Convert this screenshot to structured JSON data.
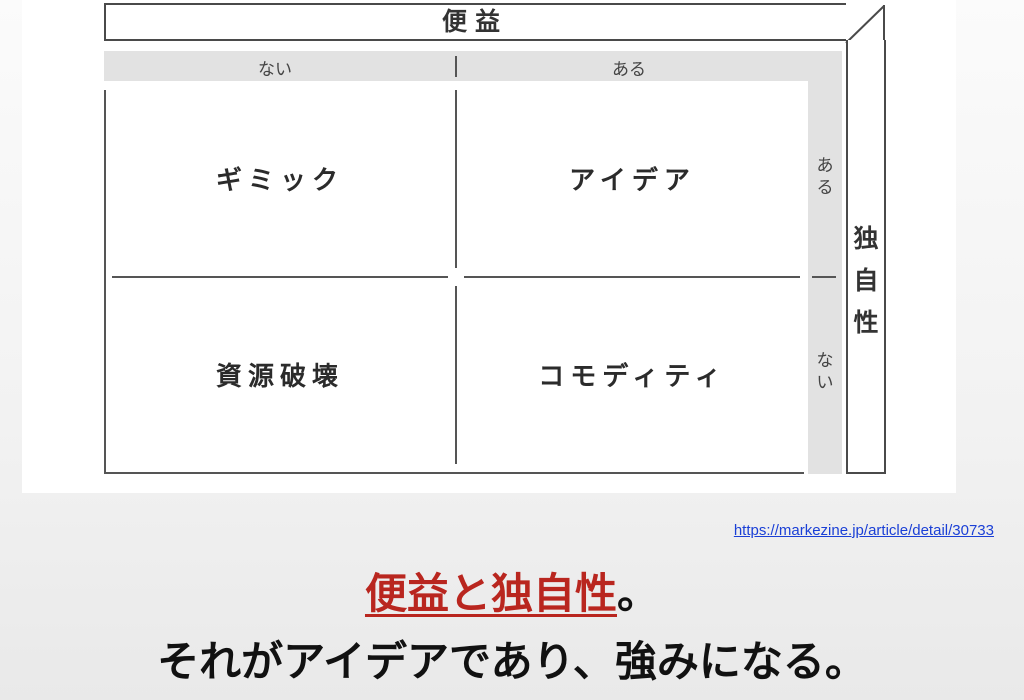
{
  "diagram": {
    "axis_top_title": "便益",
    "axis_top_left": "ない",
    "axis_top_right": "ある",
    "axis_right_title": [
      "独",
      "自",
      "性"
    ],
    "axis_right_top": [
      "あ",
      "る"
    ],
    "axis_right_bottom": [
      "な",
      "い"
    ],
    "quadrants": {
      "top_left": "ギミック",
      "top_right": "アイデア",
      "bottom_left": "資源破壊",
      "bottom_right": "コモディティ"
    }
  },
  "source_url": "https://markezine.jp/article/detail/30733",
  "headline": {
    "highlight": "便益と独自性",
    "punct": "。",
    "line2": "それがアイデアであり、強みになる。"
  },
  "colors": {
    "highlight": "#b9261f",
    "link": "#1a3fd6",
    "band": "#e2e2e2"
  }
}
